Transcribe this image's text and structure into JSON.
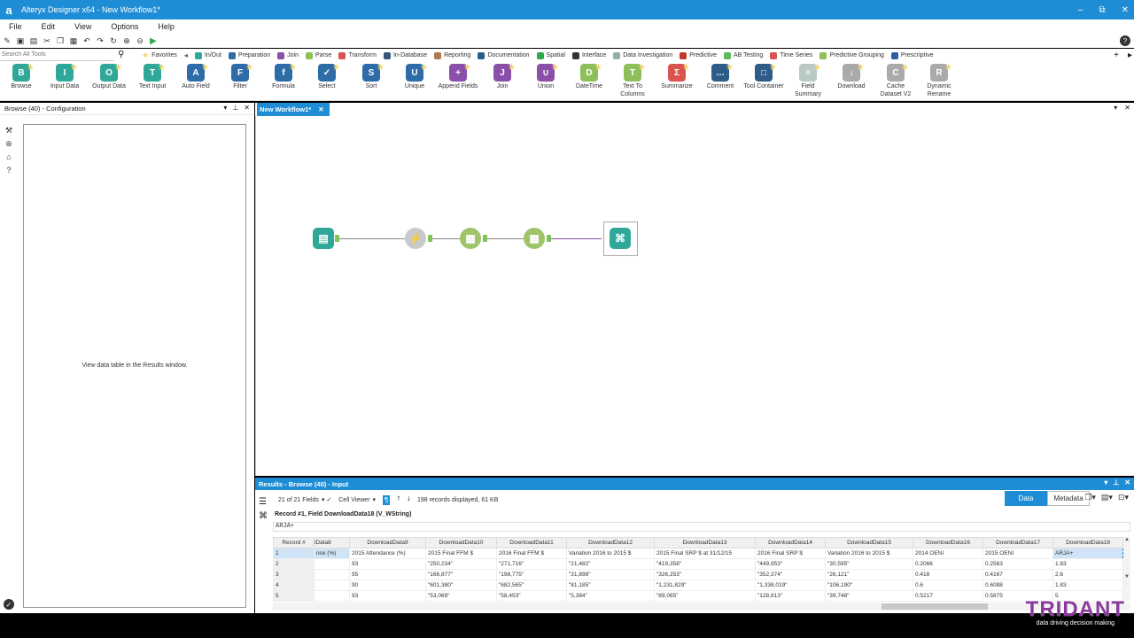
{
  "window": {
    "title": "Alteryx Designer x64 - New Workflow1*",
    "logo": "a",
    "minimize": "–",
    "maximize": "⧉",
    "close": "✕"
  },
  "menu": [
    "File",
    "Edit",
    "View",
    "Options",
    "Help"
  ],
  "search": {
    "placeholder": "Search All Tools"
  },
  "categories": [
    {
      "label": "Favorites",
      "color": "#f5d76e"
    },
    {
      "label": "In/Out",
      "color": "#2fa89a"
    },
    {
      "label": "Preparation",
      "color": "#2e6ca8"
    },
    {
      "label": "Join",
      "color": "#8a4fa8"
    },
    {
      "label": "Parse",
      "color": "#8fbf5a"
    },
    {
      "label": "Transform",
      "color": "#d9534f"
    },
    {
      "label": "In-Database",
      "color": "#37567a"
    },
    {
      "label": "Reporting",
      "color": "#b07a4f"
    },
    {
      "label": "Documentation",
      "color": "#2e5c88"
    },
    {
      "label": "Spatial",
      "color": "#2fa84f"
    },
    {
      "label": "Interface",
      "color": "#333333"
    },
    {
      "label": "Data Investigation",
      "color": "#8fb3a8"
    },
    {
      "label": "Predictive",
      "color": "#c0392b"
    },
    {
      "label": "AB Testing",
      "color": "#5cb85c"
    },
    {
      "label": "Time Series",
      "color": "#d9534f"
    },
    {
      "label": "Predictive Grouping",
      "color": "#8fbf5a"
    },
    {
      "label": "Prescriptive",
      "color": "#2e5ca8"
    }
  ],
  "tools": [
    {
      "label": "Browse",
      "color": "#2fa89a",
      "glyph": "B"
    },
    {
      "label": "Input Data",
      "color": "#2fa89a",
      "glyph": "I"
    },
    {
      "label": "Output Data",
      "color": "#2fa89a",
      "glyph": "O"
    },
    {
      "label": "Text Input",
      "color": "#2fa89a",
      "glyph": "T"
    },
    {
      "label": "Auto Field",
      "color": "#2e6ca8",
      "glyph": "A"
    },
    {
      "label": "Filter",
      "color": "#2e6ca8",
      "glyph": "F"
    },
    {
      "label": "Formula",
      "color": "#2e6ca8",
      "glyph": "f"
    },
    {
      "label": "Select",
      "color": "#2e6ca8",
      "glyph": "✓"
    },
    {
      "label": "Sort",
      "color": "#2e6ca8",
      "glyph": "S"
    },
    {
      "label": "Unique",
      "color": "#2e6ca8",
      "glyph": "U"
    },
    {
      "label": "Append Fields",
      "color": "#8a4fa8",
      "glyph": "+"
    },
    {
      "label": "Join",
      "color": "#8a4fa8",
      "glyph": "J"
    },
    {
      "label": "Union",
      "color": "#8a4fa8",
      "glyph": "∪"
    },
    {
      "label": "DateTime",
      "color": "#8fbf5a",
      "glyph": "D"
    },
    {
      "label": "Text To Columns",
      "color": "#8fbf5a",
      "glyph": "T"
    },
    {
      "label": "Summarize",
      "color": "#d9534f",
      "glyph": "Σ"
    },
    {
      "label": "Comment",
      "color": "#2e5c88",
      "glyph": "…"
    },
    {
      "label": "Tool Container",
      "color": "#2e5c88",
      "glyph": "□"
    },
    {
      "label": "Field Summary",
      "color": "#b9c9c3",
      "glyph": "≡"
    },
    {
      "label": "Download",
      "color": "#aaaaaa",
      "glyph": "↓"
    },
    {
      "label": "Cache Dataset V2",
      "color": "#aaaaaa",
      "glyph": "C"
    },
    {
      "label": "Dynamic Rename",
      "color": "#aaaaaa",
      "glyph": "R"
    }
  ],
  "config": {
    "header": "Browse (40) - Configuration",
    "message": "View data table in the Results window."
  },
  "canvas": {
    "tab_label": "New Workflow1*"
  },
  "results": {
    "header": "Results - Browse (40) - Input",
    "fields": "21 of 21 Fields",
    "viewer": "Cell Viewer",
    "records": "198 records displayed, 61 KB",
    "data_tab": "Data",
    "metadata_tab": "Metadata",
    "record_info": "Record #1, Field DownloadData18 (V_WString)",
    "record_value": "ARJA+",
    "columns": [
      "Record #",
      "lData8",
      "DownloadData9",
      "DownloadData10",
      "DownloadData11",
      "DownloadData12",
      "DownloadData13",
      "DownloadData14",
      "DownloadData15",
      "DownloadData16",
      "DownloadData17",
      "DownloadData18"
    ],
    "rows": [
      [
        "1",
        "nce (%)",
        "2015 Attendance (%)",
        "2015 Final FFM $",
        "2016 Final FFM $",
        "Variation 2016 to 2015 $",
        "2015 Final SRP $ at 31/12/15",
        "2016 Final SRP $",
        "Variation 2016 to 2015 $",
        "2014 OENI",
        "2015 OENI",
        "ARJA+"
      ],
      [
        "2",
        "",
        "93",
        "\"250,234\"",
        "\"271,716\"",
        "\"21,482\"",
        "\"419,358\"",
        "\"449,953\"",
        "\"30,595\"",
        "0.2066",
        "0.2563",
        "1.83"
      ],
      [
        "3",
        "",
        "95",
        "\"166,877\"",
        "\"198,775\"",
        "\"31,898\"",
        "\"326,253\"",
        "\"352,374\"",
        "\"26,121\"",
        "0.418",
        "0.4167",
        "2.6"
      ],
      [
        "4",
        "",
        "90",
        "\"601,380\"",
        "\"682,565\"",
        "\"81,185\"",
        "\"1,231,829\"",
        "\"1,338,019\"",
        "\"106,190\"",
        "0.6",
        "0.6088",
        "1.83"
      ],
      [
        "5",
        "",
        "93",
        "\"53,069\"",
        "\"58,453\"",
        "\"5,384\"",
        "\"89,065\"",
        "\"128,813\"",
        "\"39,748\"",
        "0.5217",
        "0.5875",
        "5"
      ]
    ]
  },
  "brand": {
    "name": "TRIDANT",
    "tagline": "data driving decision making"
  }
}
